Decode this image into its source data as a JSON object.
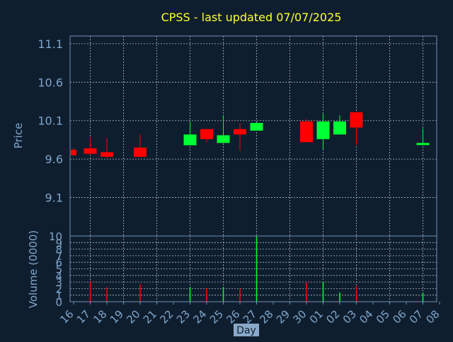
{
  "chart_data": [
    {
      "type": "candlestick",
      "title": "CPSS - last updated 07/07/2025",
      "ylabel": "Price",
      "ylim": [
        8.6,
        11.2
      ],
      "yticks": [
        "11.1",
        "10.6",
        "10.1",
        "9.6",
        "9.1"
      ],
      "ytick_values": [
        11.1,
        10.6,
        10.1,
        9.6,
        9.1
      ],
      "grid": true,
      "candles": [
        {
          "day": "16",
          "open": 9.72,
          "high": 9.74,
          "low": 9.65,
          "close": 9.65
        },
        {
          "day": "17",
          "open": 9.74,
          "high": 9.88,
          "low": 9.65,
          "close": 9.67
        },
        {
          "day": "18",
          "open": 9.69,
          "high": 9.87,
          "low": 9.61,
          "close": 9.63
        },
        {
          "day": "20",
          "open": 9.75,
          "high": 9.92,
          "low": 9.62,
          "close": 9.63
        },
        {
          "day": "23",
          "open": 9.78,
          "high": 10.08,
          "low": 9.78,
          "close": 9.92
        },
        {
          "day": "24",
          "open": 9.99,
          "high": 9.99,
          "low": 9.82,
          "close": 9.86
        },
        {
          "day": "25",
          "open": 9.81,
          "high": 10.17,
          "low": 9.81,
          "close": 9.91
        },
        {
          "day": "26",
          "open": 9.99,
          "high": 10.07,
          "low": 9.71,
          "close": 9.92
        },
        {
          "day": "27",
          "open": 9.97,
          "high": 10.08,
          "low": 9.97,
          "close": 10.07
        },
        {
          "day": "30",
          "open": 10.09,
          "high": 10.12,
          "low": 9.82,
          "close": 9.82
        },
        {
          "day": "01",
          "open": 9.86,
          "high": 10.19,
          "low": 9.73,
          "close": 10.09
        },
        {
          "day": "02",
          "open": 9.92,
          "high": 10.17,
          "low": 9.92,
          "close": 10.09
        },
        {
          "day": "03",
          "open": 10.21,
          "high": 10.21,
          "low": 9.78,
          "close": 10.01
        },
        {
          "day": "07",
          "open": 9.79,
          "high": 10.0,
          "low": 9.79,
          "close": 9.81
        }
      ]
    },
    {
      "type": "bar",
      "ylabel": "Volume (0000)",
      "xlabel": "Day",
      "ylim": [
        0,
        10
      ],
      "yticks": [
        "10",
        "9",
        "8",
        "7",
        "6",
        "5",
        "4",
        "3",
        "2",
        "1",
        "0"
      ],
      "ytick_values": [
        10,
        9,
        8,
        7,
        6,
        5,
        4,
        3,
        2,
        1,
        0
      ],
      "categories": [
        "16",
        "17",
        "18",
        "19",
        "20",
        "21",
        "22",
        "23",
        "24",
        "25",
        "26",
        "27",
        "28",
        "29",
        "30",
        "01",
        "02",
        "03",
        "04",
        "05",
        "06",
        "07",
        "08"
      ],
      "bars": [
        {
          "day": "17",
          "value": 3.0,
          "direction": "down"
        },
        {
          "day": "18",
          "value": 2.2,
          "direction": "down"
        },
        {
          "day": "20",
          "value": 2.7,
          "direction": "down"
        },
        {
          "day": "23",
          "value": 2.2,
          "direction": "up"
        },
        {
          "day": "24",
          "value": 2.0,
          "direction": "down"
        },
        {
          "day": "25",
          "value": 2.2,
          "direction": "up"
        },
        {
          "day": "26",
          "value": 2.0,
          "direction": "down"
        },
        {
          "day": "27",
          "value": 10.0,
          "direction": "up"
        },
        {
          "day": "30",
          "value": 2.9,
          "direction": "down"
        },
        {
          "day": "01",
          "value": 3.0,
          "direction": "up"
        },
        {
          "day": "02",
          "value": 1.4,
          "direction": "up"
        },
        {
          "day": "03",
          "value": 2.4,
          "direction": "down"
        },
        {
          "day": "07",
          "value": 1.4,
          "direction": "up"
        }
      ]
    }
  ],
  "colors": {
    "background": "#0f1e2e",
    "axis": "#6f8fb3",
    "grid": "#b0b8c2",
    "text": "#7fa6cc",
    "title": "#ffff33",
    "up": "#00ff33",
    "down": "#ff0000"
  }
}
